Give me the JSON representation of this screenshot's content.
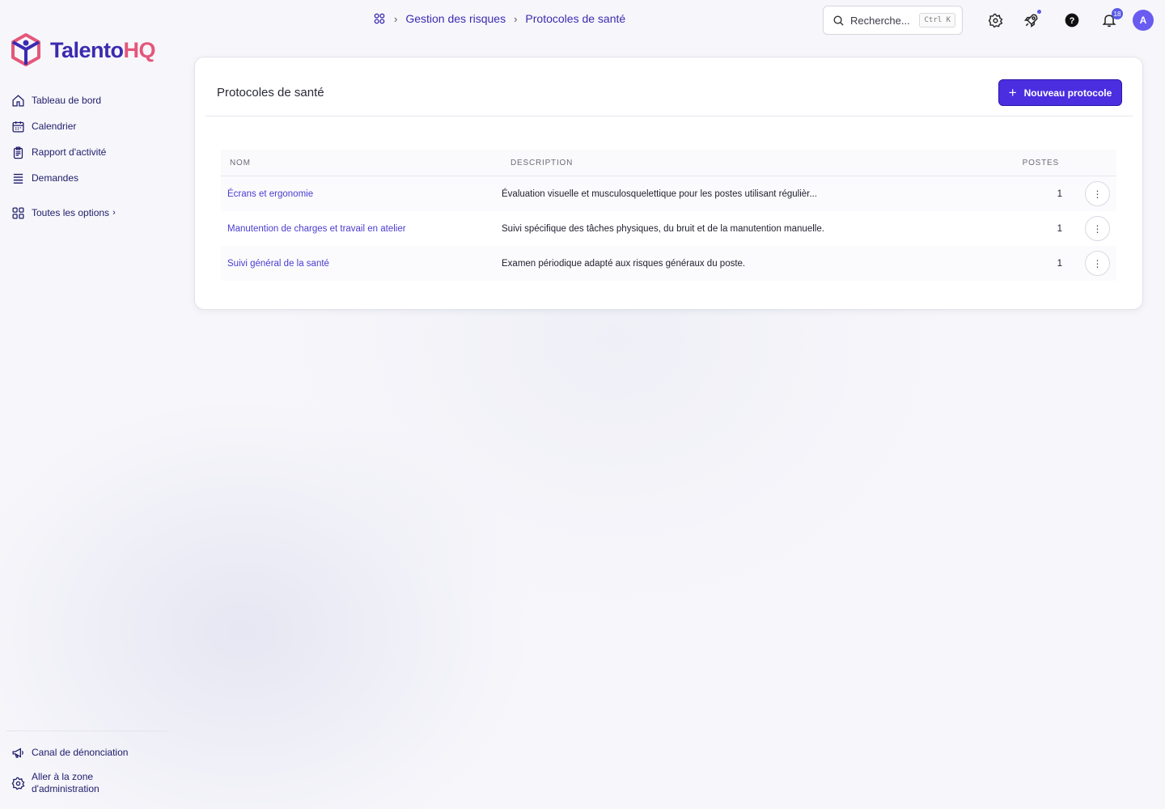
{
  "brand": {
    "name_main": "Talento",
    "name_accent": "HQ"
  },
  "sidebar": {
    "items": [
      {
        "label": "Tableau de bord",
        "icon": "home-icon"
      },
      {
        "label": "Calendrier",
        "icon": "calendar-icon"
      },
      {
        "label": "Rapport d'activité",
        "icon": "report-icon"
      },
      {
        "label": "Demandes",
        "icon": "list-icon"
      }
    ],
    "all_options": "Toutes les options",
    "bottom": [
      {
        "label": "Canal de dénonciation",
        "icon": "megaphone-icon"
      },
      {
        "label_line1": "Aller à la zone",
        "label_line2": "d'administration",
        "icon": "gear-icon"
      }
    ]
  },
  "breadcrumb": {
    "section": "Gestion des risques",
    "page": "Protocoles de santé"
  },
  "search": {
    "placeholder": "Recherche...",
    "shortcut": "Ctrl K"
  },
  "header": {
    "notifications_count": "18",
    "avatar_initial": "A"
  },
  "card": {
    "title": "Protocoles de santé",
    "new_button": "Nouveau protocole"
  },
  "table": {
    "columns": {
      "name": "NOM",
      "description": "DESCRIPTION",
      "postes": "POSTES"
    },
    "rows": [
      {
        "name": "Écrans et ergonomie",
        "description": "Évaluation visuelle et musculosquelettique pour les postes utilisant régulièr...",
        "postes": "1"
      },
      {
        "name": "Manutention de charges et travail en atelier",
        "description": "Suivi spécifique des tâches physiques, du bruit et de la manutention manuelle.",
        "postes": "1"
      },
      {
        "name": "Suivi général de la santé",
        "description": "Examen périodique adapté aux risques généraux du poste.",
        "postes": "1"
      }
    ]
  },
  "colors": {
    "accent": "#4a2ee0",
    "brand_blue": "#3a2bb0",
    "brand_pink": "#e4577a"
  }
}
